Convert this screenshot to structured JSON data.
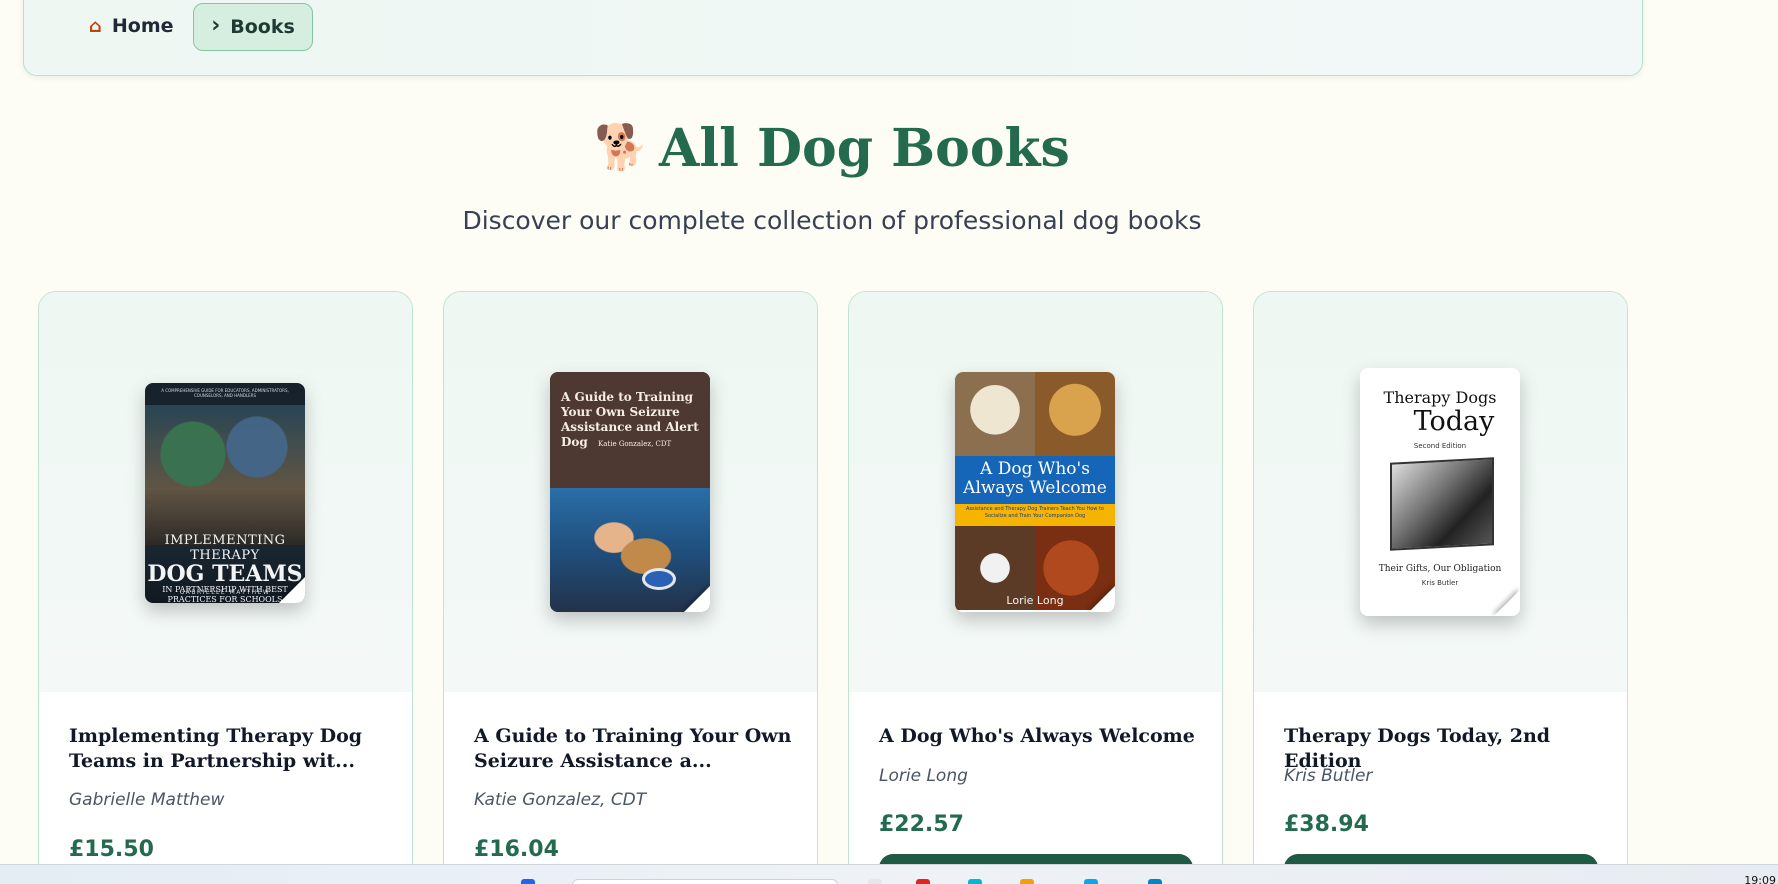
{
  "breadcrumb": {
    "home_icon": "home-icon",
    "home_label": "Home",
    "chevron_icon": "chevron-right-icon",
    "current_label": "Books"
  },
  "header": {
    "title_icon": "dog-icon",
    "title": "All Dog Books",
    "subtitle": "Discover our complete collection of professional dog books"
  },
  "books": [
    {
      "title": "Implementing Therapy Dog Teams in Partnership wit...",
      "author": "Gabrielle Matthew",
      "price": "£15.50",
      "cover": {
        "top_text": "A COMPREHENSIVE GUIDE FOR EDUCATORS, ADMINISTRATORS, COUNSELORS, AND HANDLERS",
        "title_line1": "IMPLEMENTING THERAPY",
        "title_line2": "DOG TEAMS",
        "title_line3": "IN PARTNERSHIP WITH BEST PRACTICES FOR SCHOOLS",
        "author": "GABRIELLE MATTHEW"
      }
    },
    {
      "title": "A Guide to Training Your Own Seizure Assistance a...",
      "author": "Katie Gonzalez, CDT",
      "price": "£16.04",
      "cover": {
        "title": "A Guide to Training Your Own Seizure Assistance and Alert Dog",
        "author": "Katie Gonzalez, CDT"
      }
    },
    {
      "title": "A Dog Who's Always Welcome",
      "author": "Lorie Long",
      "price": "£22.57",
      "cover": {
        "title": "A Dog Who's Always Welcome",
        "strip": "Assistance and Therapy Dog Trainers Teach You How to Socialize and Train Your Companion Dog",
        "author": "Lorie Long"
      }
    },
    {
      "title": "Therapy Dogs Today, 2nd Edition",
      "author": "Kris Butler",
      "price": "£38.94",
      "cover": {
        "line1": "Therapy Dogs",
        "line2": "Today",
        "edition": "Second Edition",
        "subtitle": "Their Gifts, Our Obligation",
        "author": "Kris Butler"
      }
    }
  ],
  "taskbar": {
    "clock": "19:09"
  }
}
